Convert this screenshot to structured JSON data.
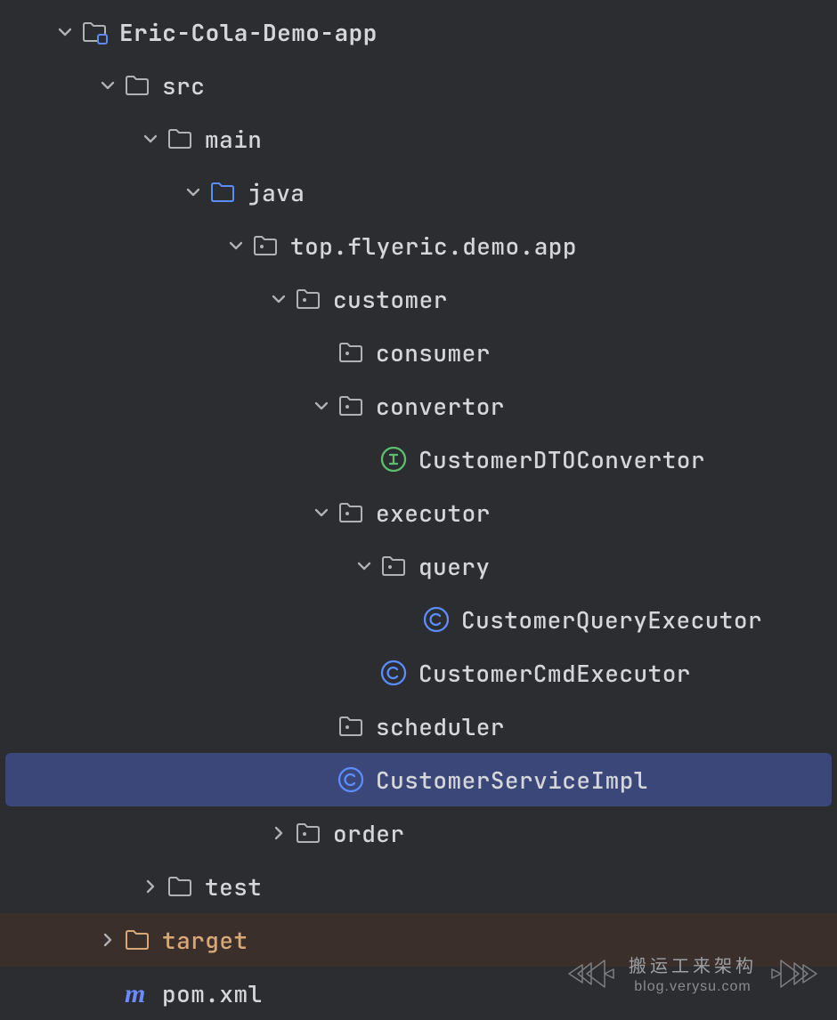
{
  "tree": {
    "root": {
      "label": "Eric-Cola-Demo-app",
      "icon": "module-folder",
      "chevron": "down",
      "bold": true
    },
    "src": {
      "label": "src",
      "icon": "folder",
      "chevron": "down"
    },
    "main": {
      "label": "main",
      "icon": "folder",
      "chevron": "down"
    },
    "java": {
      "label": "java",
      "icon": "folder-src",
      "chevron": "down"
    },
    "pkg": {
      "label": "top.flyeric.demo.app",
      "icon": "package",
      "chevron": "down"
    },
    "customer": {
      "label": "customer",
      "icon": "package",
      "chevron": "down"
    },
    "consumer": {
      "label": "consumer",
      "icon": "package",
      "chevron": ""
    },
    "convertor": {
      "label": "convertor",
      "icon": "package",
      "chevron": "down"
    },
    "dtoConv": {
      "label": "CustomerDTOConvertor",
      "icon": "interface",
      "chevron": ""
    },
    "executor": {
      "label": "executor",
      "icon": "package",
      "chevron": "down"
    },
    "query": {
      "label": "query",
      "icon": "package",
      "chevron": "down"
    },
    "queryExec": {
      "label": "CustomerQueryExecutor",
      "icon": "class",
      "chevron": ""
    },
    "cmdExec": {
      "label": "CustomerCmdExecutor",
      "icon": "class",
      "chevron": ""
    },
    "scheduler": {
      "label": "scheduler",
      "icon": "package",
      "chevron": ""
    },
    "serviceImpl": {
      "label": "CustomerServiceImpl",
      "icon": "class",
      "chevron": "",
      "selected": true
    },
    "order": {
      "label": "order",
      "icon": "package",
      "chevron": "right"
    },
    "test": {
      "label": "test",
      "icon": "folder",
      "chevron": "right"
    },
    "target": {
      "label": "target",
      "icon": "folder-excluded",
      "chevron": "right",
      "excluded": true
    },
    "pom": {
      "label": "pom.xml",
      "icon": "maven",
      "chevron": ""
    }
  },
  "watermark": {
    "title": "搬运工来架构",
    "url": "blog.verysu.com"
  }
}
